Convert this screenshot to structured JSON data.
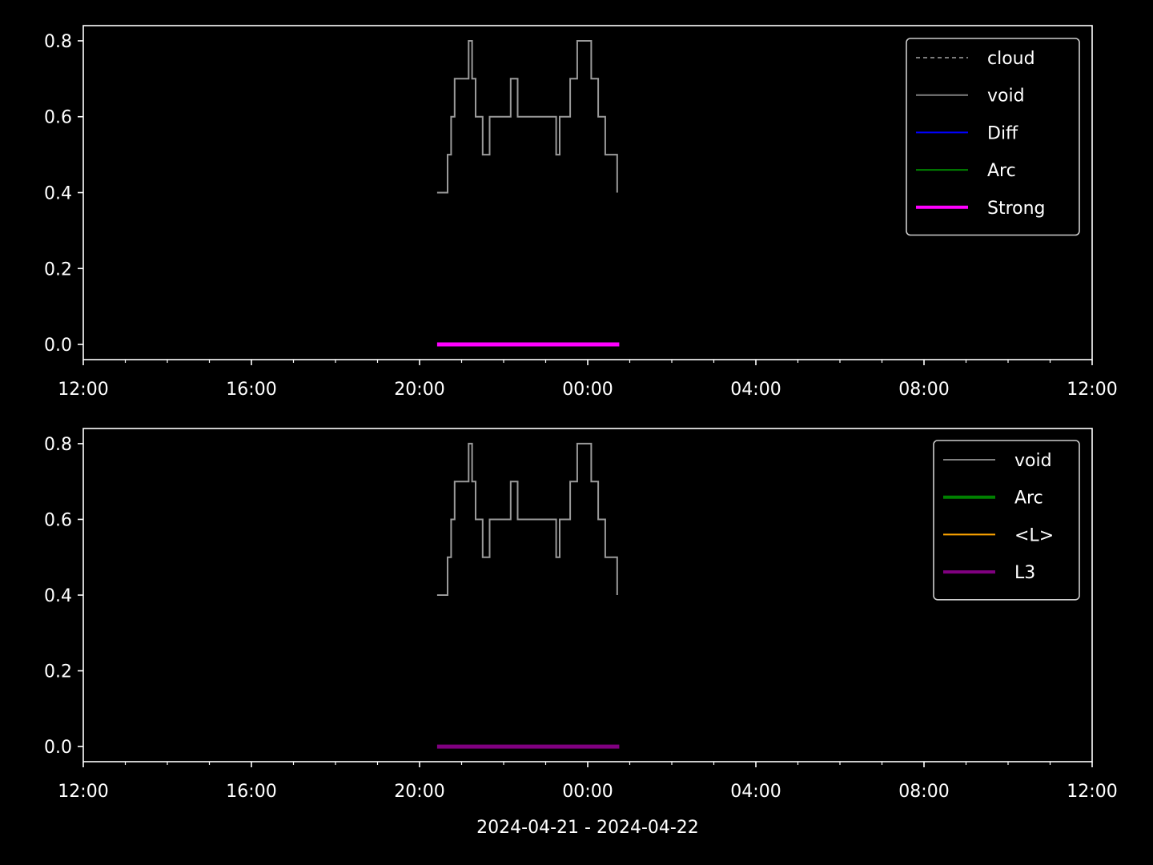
{
  "figure": {
    "background": "#000000",
    "foreground": "#ffffff",
    "xlabel": "2024-04-21 - 2024-04-22"
  },
  "chart_data": [
    {
      "type": "line",
      "xlim": [
        "2024-04-21 12:00",
        "2024-04-22 12:00"
      ],
      "ylim": [
        -0.04,
        0.84
      ],
      "x_ticks": [
        "12:00",
        "16:00",
        "20:00",
        "00:00",
        "04:00",
        "08:00",
        "12:00"
      ],
      "y_ticks": [
        "0.0",
        "0.2",
        "0.4",
        "0.6",
        "0.8"
      ],
      "legend_position": "upper right",
      "legend": [
        {
          "name": "cloud",
          "color": "#a6a6a6",
          "style": "dashed",
          "width": 1.5
        },
        {
          "name": "void",
          "color": "#808080",
          "style": "solid",
          "width": 2
        },
        {
          "name": "Diff",
          "color": "#0000ff",
          "style": "solid",
          "width": 2
        },
        {
          "name": "Arc",
          "color": "#008000",
          "style": "solid",
          "width": 2
        },
        {
          "name": "Strong",
          "color": "#ff00ff",
          "style": "solid",
          "width": 4
        }
      ],
      "series": [
        {
          "name": "void",
          "color": "#9a9a9a",
          "width": 2,
          "step": true,
          "x": [
            "2024-04-21 20:25",
            "2024-04-21 20:40",
            "2024-04-21 20:45",
            "2024-04-21 20:50",
            "2024-04-21 21:00",
            "2024-04-21 21:10",
            "2024-04-21 21:15",
            "2024-04-21 21:20",
            "2024-04-21 21:30",
            "2024-04-21 21:40",
            "2024-04-21 22:00",
            "2024-04-21 22:10",
            "2024-04-21 22:20",
            "2024-04-21 22:30",
            "2024-04-21 22:40",
            "2024-04-21 23:00",
            "2024-04-21 23:15",
            "2024-04-21 23:20",
            "2024-04-21 23:35",
            "2024-04-21 23:45",
            "2024-04-22 00:05",
            "2024-04-22 00:10",
            "2024-04-22 00:15",
            "2024-04-22 00:25",
            "2024-04-22 00:30",
            "2024-04-22 00:40",
            "2024-04-22 00:42"
          ],
          "y": [
            0.4,
            0.5,
            0.6,
            0.7,
            0.7,
            0.8,
            0.7,
            0.6,
            0.5,
            0.6,
            0.6,
            0.7,
            0.6,
            0.6,
            0.6,
            0.6,
            0.5,
            0.6,
            0.7,
            0.8,
            0.7,
            0.7,
            0.6,
            0.5,
            0.5,
            0.5,
            0.4
          ]
        },
        {
          "name": "Strong",
          "color": "#ff00ff",
          "width": 5,
          "step": false,
          "x": [
            "2024-04-21 20:25",
            "2024-04-22 00:45"
          ],
          "y": [
            0.0,
            0.0
          ]
        }
      ]
    },
    {
      "type": "line",
      "xlim": [
        "2024-04-21 12:00",
        "2024-04-22 12:00"
      ],
      "ylim": [
        -0.04,
        0.84
      ],
      "x_ticks": [
        "12:00",
        "16:00",
        "20:00",
        "00:00",
        "04:00",
        "08:00",
        "12:00"
      ],
      "y_ticks": [
        "0.0",
        "0.2",
        "0.4",
        "0.6",
        "0.8"
      ],
      "legend_position": "upper right",
      "legend": [
        {
          "name": "void",
          "color": "#808080",
          "style": "solid",
          "width": 2
        },
        {
          "name": "Arc",
          "color": "#008000",
          "style": "solid",
          "width": 4
        },
        {
          "name": "<L>",
          "color": "#ffa500",
          "style": "solid",
          "width": 2
        },
        {
          "name": "L3",
          "color": "#800080",
          "style": "solid",
          "width": 4
        }
      ],
      "series": [
        {
          "name": "void",
          "color": "#9a9a9a",
          "width": 2,
          "step": true,
          "x": [
            "2024-04-21 20:25",
            "2024-04-21 20:40",
            "2024-04-21 20:45",
            "2024-04-21 20:50",
            "2024-04-21 21:00",
            "2024-04-21 21:10",
            "2024-04-21 21:15",
            "2024-04-21 21:20",
            "2024-04-21 21:30",
            "2024-04-21 21:40",
            "2024-04-21 22:00",
            "2024-04-21 22:10",
            "2024-04-21 22:20",
            "2024-04-21 22:30",
            "2024-04-21 22:40",
            "2024-04-21 23:00",
            "2024-04-21 23:15",
            "2024-04-21 23:20",
            "2024-04-21 23:35",
            "2024-04-21 23:45",
            "2024-04-22 00:05",
            "2024-04-22 00:10",
            "2024-04-22 00:15",
            "2024-04-22 00:25",
            "2024-04-22 00:30",
            "2024-04-22 00:40",
            "2024-04-22 00:42"
          ],
          "y": [
            0.4,
            0.5,
            0.6,
            0.7,
            0.7,
            0.8,
            0.7,
            0.6,
            0.5,
            0.6,
            0.6,
            0.7,
            0.6,
            0.6,
            0.6,
            0.6,
            0.5,
            0.6,
            0.7,
            0.8,
            0.7,
            0.7,
            0.6,
            0.5,
            0.5,
            0.5,
            0.4
          ]
        },
        {
          "name": "L3",
          "color": "#800080",
          "width": 5,
          "step": false,
          "x": [
            "2024-04-21 20:25",
            "2024-04-22 00:45"
          ],
          "y": [
            0.0,
            0.0
          ]
        }
      ]
    }
  ]
}
